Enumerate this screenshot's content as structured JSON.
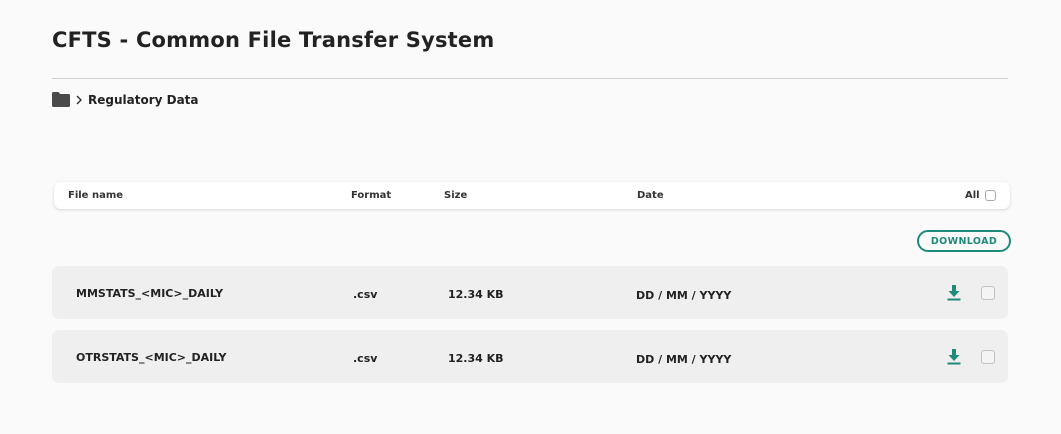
{
  "page": {
    "title": "CFTS - Common File Transfer System"
  },
  "breadcrumb": {
    "root_icon": "folder-icon",
    "separator_icon": "chevron-right-icon",
    "current": "Regulatory Data"
  },
  "table": {
    "headers": {
      "file_name": "File name",
      "format": "Format",
      "size": "Size",
      "date": "Date",
      "select_all": "All"
    },
    "rows": [
      {
        "name": "MMSTATS_<MIC>_DAILY",
        "format": ".csv",
        "size": "12.34 KB",
        "date": "DD / MM / YYYY",
        "action_icon": "download-icon",
        "selected": false
      },
      {
        "name": "OTRSTATS_<MIC>_DAILY",
        "format": ".csv",
        "size": "12.34 KB",
        "date": "DD / MM / YYYY",
        "action_icon": "download-icon",
        "selected": false
      }
    ]
  },
  "actions": {
    "download_label": "DOWNLOAD"
  },
  "colors": {
    "accent": "#1f8a7a",
    "background": "#fafafa",
    "row_background": "#efefef",
    "text": "#222222"
  }
}
